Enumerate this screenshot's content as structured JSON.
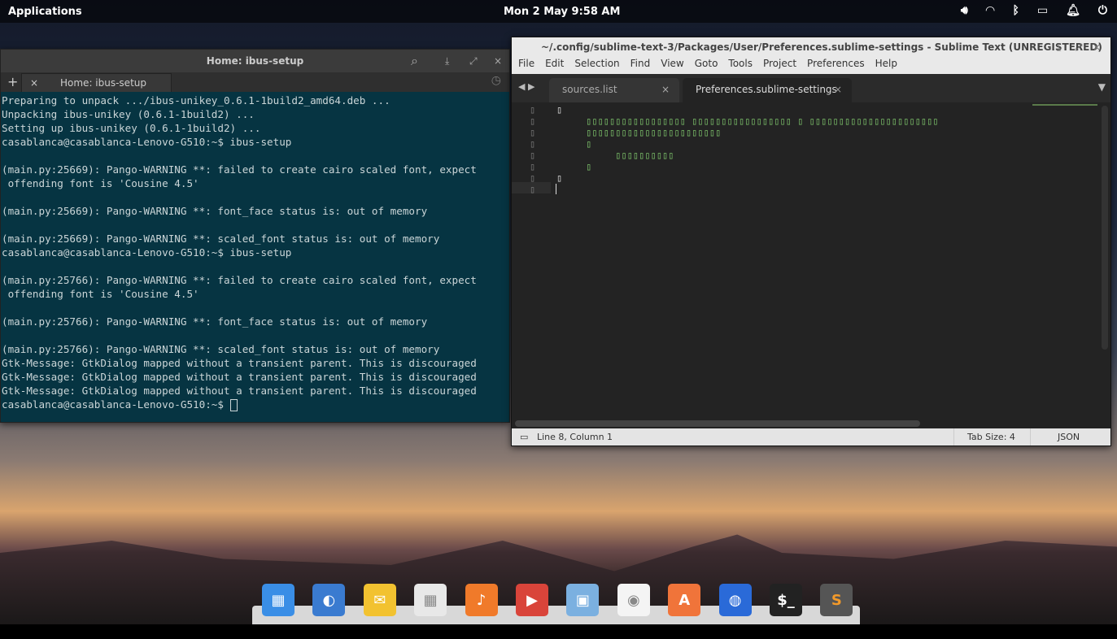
{
  "panel": {
    "applications": "Applications",
    "clock": "Mon  2 May   9:58 AM",
    "indicators": [
      "volume-icon",
      "wifi-icon",
      "bluetooth-icon",
      "battery-icon",
      "notifications-icon",
      "power-icon"
    ]
  },
  "terminal": {
    "title": "Home: ibus-setup",
    "tab_label": "Home: ibus-setup",
    "lines": [
      "Preparing to unpack .../ibus-unikey_0.6.1-1build2_amd64.deb ...",
      "Unpacking ibus-unikey (0.6.1-1build2) ...",
      "Setting up ibus-unikey (0.6.1-1build2) ...",
      "casablanca@casablanca-Lenovo-G510:~$ ibus-setup",
      "",
      "(main.py:25669): Pango-WARNING **: failed to create cairo scaled font, expect",
      " offending font is 'Cousine 4.5'",
      "",
      "(main.py:25669): Pango-WARNING **: font_face status is: out of memory",
      "",
      "(main.py:25669): Pango-WARNING **: scaled_font status is: out of memory",
      "casablanca@casablanca-Lenovo-G510:~$ ibus-setup",
      "",
      "(main.py:25766): Pango-WARNING **: failed to create cairo scaled font, expect",
      " offending font is 'Cousine 4.5'",
      "",
      "(main.py:25766): Pango-WARNING **: font_face status is: out of memory",
      "",
      "(main.py:25766): Pango-WARNING **: scaled_font status is: out of memory",
      "Gtk-Message: GtkDialog mapped without a transient parent. This is discouraged",
      "Gtk-Message: GtkDialog mapped without a transient parent. This is discouraged",
      "Gtk-Message: GtkDialog mapped without a transient parent. This is discouraged"
    ],
    "prompt": "casablanca@casablanca-Lenovo-G510:~$ "
  },
  "sublime": {
    "title": "~/.config/sublime-text-3/Packages/User/Preferences.sublime-settings - Sublime Text (UNREGISTERED)",
    "menu": [
      "File",
      "Edit",
      "Selection",
      "Find",
      "View",
      "Goto",
      "Tools",
      "Project",
      "Preferences",
      "Help"
    ],
    "tabs": [
      {
        "label": "sources.list"
      },
      {
        "label": "Preferences.sublime-settings"
      }
    ],
    "gutter": [
      "▯",
      "▯",
      "▯",
      "▯",
      "▯",
      "▯",
      "▯",
      "▯"
    ],
    "code": [
      "▯",
      "     ▯▯▯▯▯▯▯▯▯▯▯▯▯▯▯▯▯ ▯▯▯▯▯▯▯▯▯▯▯▯▯▯▯▯▯ ▯ ▯▯▯▯▯▯▯▯▯▯▯▯▯▯▯▯▯▯▯▯▯▯",
      "     ▯▯▯▯▯▯▯▯▯▯▯▯▯▯▯▯▯▯▯▯▯▯▯",
      "     ▯",
      "          ▯▯▯▯▯▯▯▯▯▯",
      "     ▯",
      "▯",
      ""
    ],
    "status": {
      "position": "Line 8, Column 1",
      "tab_size": "Tab Size: 4",
      "syntax": "JSON"
    }
  },
  "dock": [
    "multitasking-view",
    "web-browser",
    "mail",
    "calendar",
    "music",
    "videos",
    "photos",
    "system-settings",
    "app-center",
    "firefox",
    "terminal",
    "sublime-text"
  ]
}
